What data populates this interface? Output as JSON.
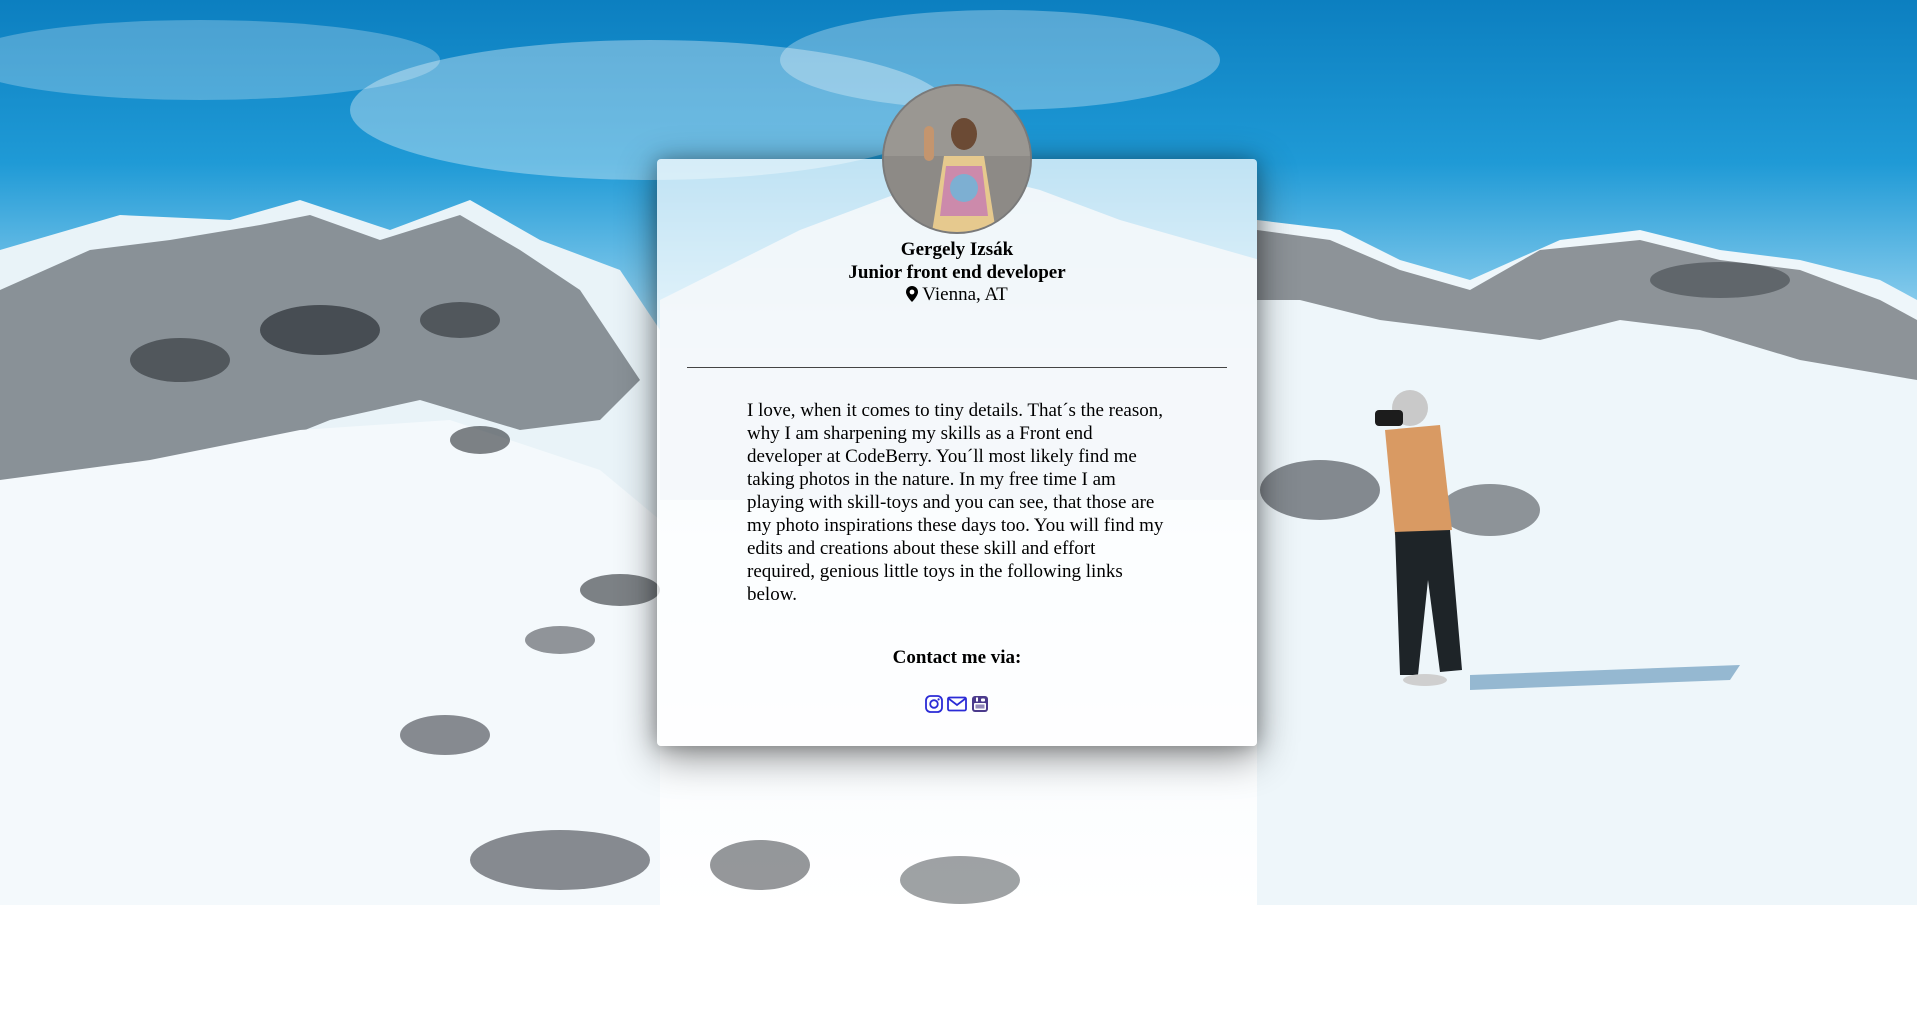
{
  "profile": {
    "name": "Gergely Izsák",
    "role": "Junior front end developer",
    "location": "Vienna, AT"
  },
  "bio": "I love, when it comes to tiny details. That´s the reason, why I am sharpening my skills as a Front end developer at CodeBerry. You´ll most likely find me taking photos in the nature. In my free time I am playing with skill-toys and you can see, that those are my photo inspirations these days too. You will find my edits and creations about these skill and effort required, genious little toys in the following links below.",
  "contact": {
    "heading": "Contact me via:",
    "links": [
      {
        "icon": "instagram-icon"
      },
      {
        "icon": "envelope-icon"
      },
      {
        "icon": "youtube-icon"
      }
    ]
  },
  "colors": {
    "link": "#2b2bd6",
    "sky": "#1f9ad6",
    "snow": "#ffffff"
  }
}
